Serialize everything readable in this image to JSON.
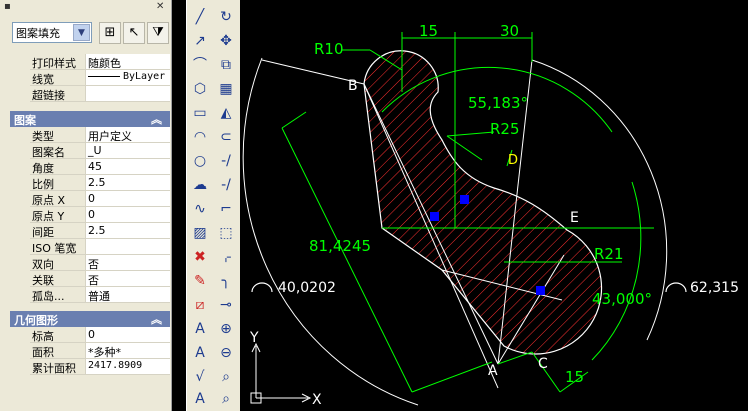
{
  "properties_panel": {
    "object_type": "图案填充",
    "general": [
      {
        "key": "打印样式",
        "value": "随颜色"
      },
      {
        "key": "线宽",
        "value": "ByLayer"
      },
      {
        "key": "超链接",
        "value": ""
      }
    ],
    "pattern_section": "图案",
    "pattern": [
      {
        "key": "类型",
        "value": "用户定义"
      },
      {
        "key": "图案名",
        "value": "_U"
      },
      {
        "key": "角度",
        "value": "45"
      },
      {
        "key": "比例",
        "value": "2.5"
      },
      {
        "key": "原点 X",
        "value": "0"
      },
      {
        "key": "原点 Y",
        "value": "0"
      },
      {
        "key": "间距",
        "value": "2.5"
      },
      {
        "key": "ISO 笔宽",
        "value": ""
      },
      {
        "key": "双向",
        "value": "否"
      },
      {
        "key": "关联",
        "value": "否"
      },
      {
        "key": "孤岛...",
        "value": "普通"
      }
    ],
    "geometry_section": "几何图形",
    "geometry": [
      {
        "key": "标高",
        "value": "0"
      },
      {
        "key": "面积",
        "value": "*多种*"
      },
      {
        "key": "累计面积",
        "value": "2417.8909"
      }
    ]
  },
  "drawing": {
    "dimensions": {
      "d15_top": "15",
      "d30": "30",
      "r10": "R10",
      "angle_55": "55,183°",
      "r25": "R25",
      "aligned_81": "81,4245",
      "r21": "R21",
      "angle_43": "43,000°",
      "arc_40": "40,0202",
      "arc_62": "62,315",
      "d15_bottom": "15"
    },
    "points": {
      "a": "A",
      "b": "B",
      "c": "C",
      "d": "D",
      "e": "E"
    },
    "ucs": {
      "x": "X",
      "y": "Y"
    },
    "colors": {
      "dimension": "#00ff00",
      "geometry": "#ffffff",
      "hatch": "#ff0000",
      "grip": "#0000ff",
      "label": "#ffff00"
    }
  }
}
